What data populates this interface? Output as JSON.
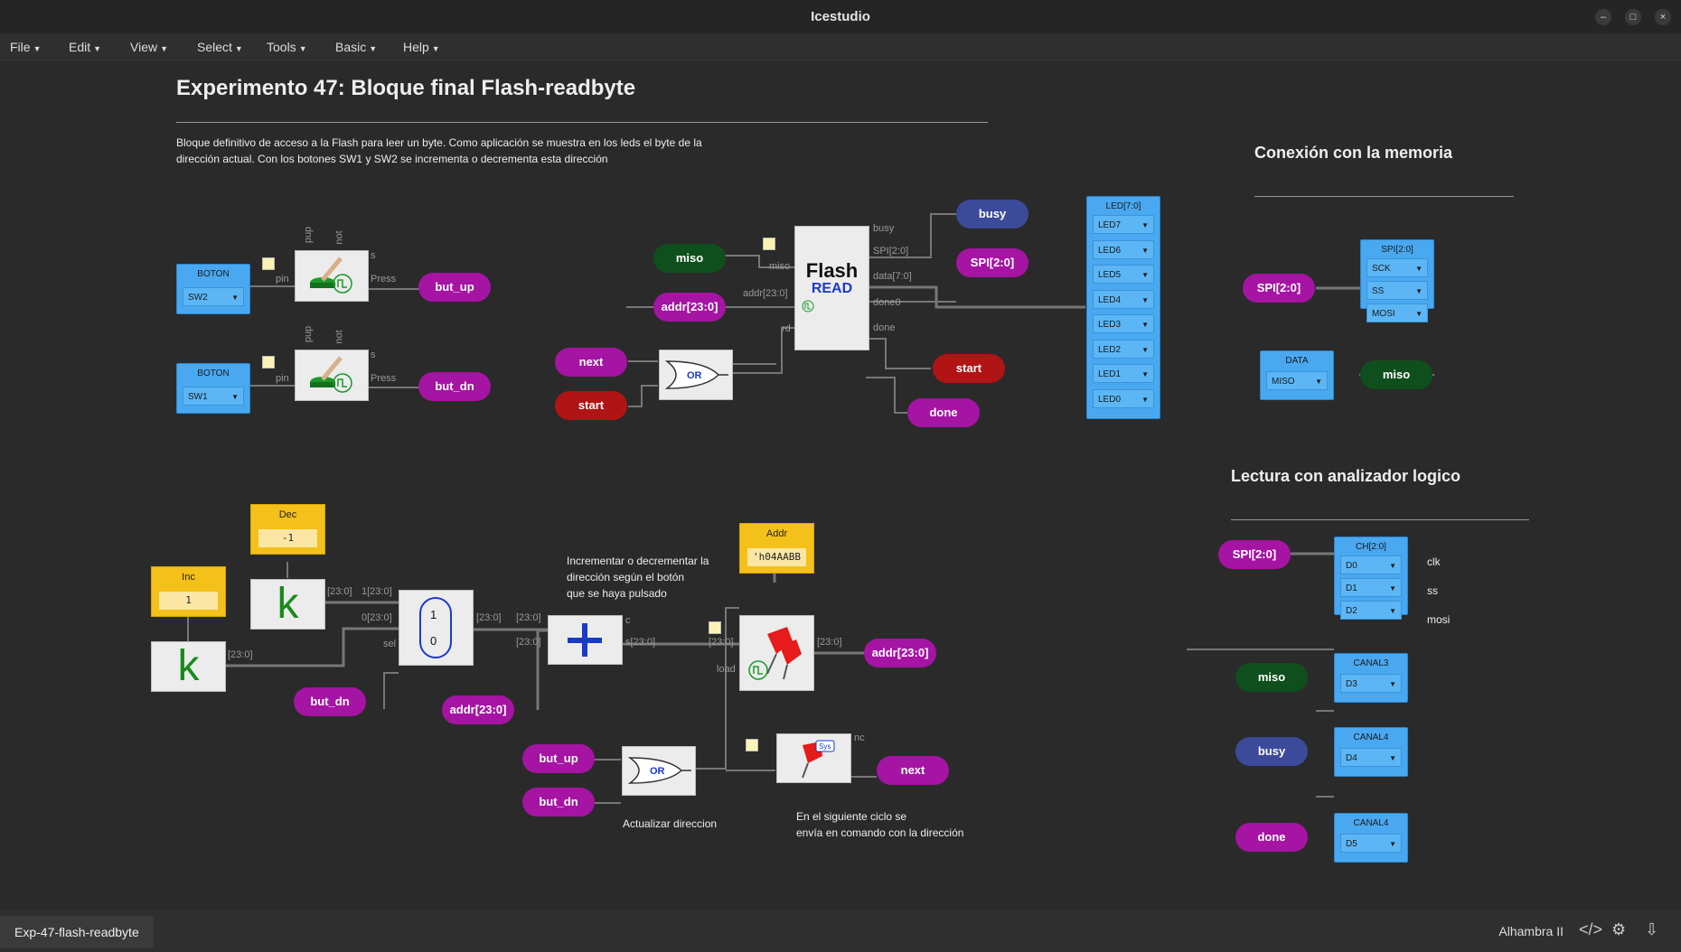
{
  "window": {
    "title": "Icestudio"
  },
  "menu": [
    "File",
    "Edit",
    "View",
    "Select",
    "Tools",
    "Basic",
    "Help"
  ],
  "design": {
    "title": "Experimento 47: Bloque final Flash-readbyte",
    "desc1": "Bloque definitivo de acceso a la Flash para leer un byte. Como aplicación se muestra en los leds el byte de la",
    "desc2": "dirección actual. Con los botones SW1 y SW2 se incrementa o decrementa esta dirección",
    "section_mem": "Conexión con la memoria",
    "section_logic": "Lectura con analizador logico",
    "note_incdec1": "Incrementar o decrementar la",
    "note_incdec2": "dirección según el botón",
    "note_incdec3": "que se haya pulsado",
    "note_update": "Actualizar direccion",
    "note_next1": "En el siguiente ciclo se",
    "note_next2": "envía en comando con la dirección"
  },
  "labels": {
    "but_up": "but_up",
    "but_dn": "but_dn",
    "miso": "miso",
    "addr": "addr[23:0]",
    "next": "next",
    "start": "start",
    "busy": "busy",
    "spi": "SPI[2:0]",
    "done": "done",
    "clk": "clk",
    "ss": "ss",
    "mosi": "mosi"
  },
  "buttons": {
    "title": "BOTON",
    "sw2": "SW2",
    "sw1": "SW1",
    "pup": "pup",
    "not": "not",
    "s": "s",
    "pin": "pin",
    "press": "Press"
  },
  "flash": {
    "name": "Flash",
    "sub": "READ",
    "ports": {
      "busy": "busy",
      "spi": "SPI[2:0]",
      "data": "data[7:0]",
      "done0": "done0",
      "done": "done",
      "miso": "miso",
      "addr": "addr[23:0]",
      "rd": "rd"
    }
  },
  "gate_or": "OR",
  "leds": {
    "title": "LED[7:0]",
    "items": [
      "LED7",
      "LED6",
      "LED5",
      "LED4",
      "LED3",
      "LED2",
      "LED1",
      "LED0"
    ]
  },
  "spi_out": {
    "title": "SPI[2:0]",
    "items": [
      "SCK",
      "SS",
      "MOSI"
    ]
  },
  "data_in": {
    "title": "DATA",
    "item": "MISO"
  },
  "analyzer": {
    "ch": {
      "title": "CH[2:0]",
      "items": [
        "D0",
        "D1",
        "D2"
      ]
    },
    "c3": {
      "title": "CANAL3",
      "item": "D3"
    },
    "c4a": {
      "title": "CANAL4",
      "item": "D4"
    },
    "c4b": {
      "title": "CANAL4",
      "item": "D5"
    }
  },
  "constants": {
    "dec": {
      "title": "Dec",
      "value": "-1"
    },
    "inc": {
      "title": "Inc",
      "value": "1"
    },
    "addr": {
      "title": "Addr",
      "value": "'h04AABB"
    },
    "k": "k"
  },
  "mux": {
    "one": "1",
    "zero": "0",
    "p23": "[23:0]",
    "p1": "1[23:0]",
    "p0": "0[23:0]",
    "sel": "sel"
  },
  "adder": {
    "c": "c",
    "s": "s[23:0]",
    "a": "[23:0]"
  },
  "reg": {
    "load": "load",
    "in": "[23:0]",
    "out": "[23:0]",
    "nc": "nc",
    "sys": "Sys"
  },
  "status": {
    "tab": "Exp-47-flash-readbyte",
    "board": "Alhambra II"
  },
  "colors": {
    "purple": "#a514a3",
    "green": "#0f4f1d",
    "red": "#b01414",
    "blue": "#3b4b9a",
    "io": "#4aa8f0",
    "const": "#f4c01a"
  }
}
